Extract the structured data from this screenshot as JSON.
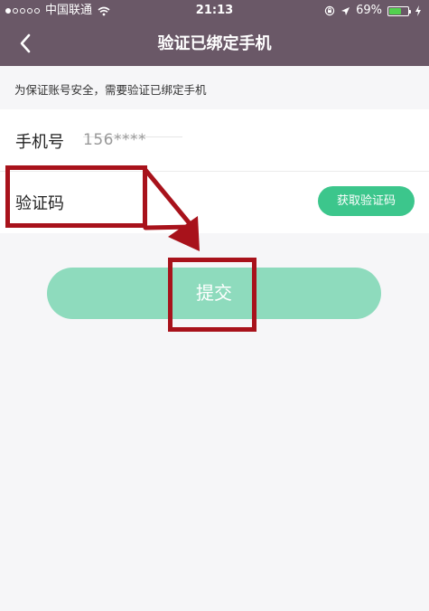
{
  "status_bar": {
    "carrier": "中国联通",
    "time": "21:13",
    "battery": "69%",
    "battery_level": 0.69,
    "signal_icon": "signal-dots-icon",
    "wifi_icon": "wifi-icon",
    "location_icon": "location-arrow-icon",
    "lock_icon": "orientation-lock-icon",
    "charging_icon": "charging-bolt-icon"
  },
  "nav": {
    "title": "验证已绑定手机",
    "back_icon": "chevron-left-icon"
  },
  "hint": "为保证账号安全，需要验证已绑定手机",
  "form": {
    "phone_label": "手机号",
    "phone_value": "156****",
    "code_label": "验证码",
    "code_value": "",
    "get_code_button": "获取验证码"
  },
  "submit_button": "提交",
  "colors": {
    "topbar": "#6a5867",
    "accent": "#3cc68c",
    "submit": "#8edbbd",
    "annotation": "#a8121b"
  }
}
